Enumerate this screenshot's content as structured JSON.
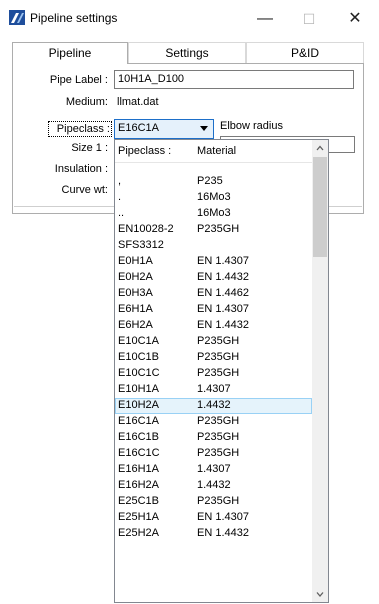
{
  "window": {
    "title": "Pipeline settings",
    "minimize": "—",
    "maximize": "☐",
    "close": "✕"
  },
  "tabs": [
    {
      "label": "Pipeline"
    },
    {
      "label": "Settings"
    },
    {
      "label": "P&ID"
    }
  ],
  "form": {
    "pipe_label_label": "Pipe Label :",
    "pipe_label_value": "10H1A_D100",
    "medium_label": "Medium:",
    "medium_value": "llmat.dat",
    "pipeclass_label": "Pipeclass :",
    "pipeclass_value": "E16C1A",
    "elbow_radius_label": "Elbow radius",
    "size_label": "Size 1 :",
    "insulation_label": "Insulation :",
    "curve_wt_label": "Curve wt:"
  },
  "dropdown": {
    "header_col1": "Pipeclass :",
    "header_col2": "Material",
    "selected_index": 14,
    "items": [
      {
        "pipeclass": ",",
        "material": "P235"
      },
      {
        "pipeclass": ".",
        "material": "16Mo3"
      },
      {
        "pipeclass": "..",
        "material": "16Mo3"
      },
      {
        "pipeclass": "EN10028-2",
        "material": "P235GH"
      },
      {
        "pipeclass": "SFS3312",
        "material": ""
      },
      {
        "pipeclass": "E0H1A",
        "material": "EN 1.4307"
      },
      {
        "pipeclass": "E0H2A",
        "material": "EN 1.4432"
      },
      {
        "pipeclass": "E0H3A",
        "material": "EN 1.4462"
      },
      {
        "pipeclass": "E6H1A",
        "material": "EN 1.4307"
      },
      {
        "pipeclass": "E6H2A",
        "material": "EN 1.4432"
      },
      {
        "pipeclass": "E10C1A",
        "material": "P235GH"
      },
      {
        "pipeclass": "E10C1B",
        "material": "P235GH"
      },
      {
        "pipeclass": "E10C1C",
        "material": "P235GH"
      },
      {
        "pipeclass": "E10H1A",
        "material": "1.4307"
      },
      {
        "pipeclass": "E10H2A",
        "material": "1.4432"
      },
      {
        "pipeclass": "E16C1A",
        "material": "P235GH"
      },
      {
        "pipeclass": "E16C1B",
        "material": "P235GH"
      },
      {
        "pipeclass": "E16C1C",
        "material": "P235GH"
      },
      {
        "pipeclass": "E16H1A",
        "material": "1.4307"
      },
      {
        "pipeclass": "E16H2A",
        "material": "1.4432"
      },
      {
        "pipeclass": "E25C1B",
        "material": "P235GH"
      },
      {
        "pipeclass": "E25H1A",
        "material": "EN 1.4307"
      },
      {
        "pipeclass": "E25H2A",
        "material": "EN 1.4432"
      }
    ]
  },
  "colors": {
    "accent": "#1d6fc9",
    "selection_bg": "#e5f3fb",
    "selection_border": "#99d1f5"
  },
  "icons": {
    "app": "pipeline-app-icon",
    "combo_arrow": "chevron-down-icon",
    "scroll_up": "chevron-up-icon",
    "scroll_down": "chevron-down-icon"
  }
}
